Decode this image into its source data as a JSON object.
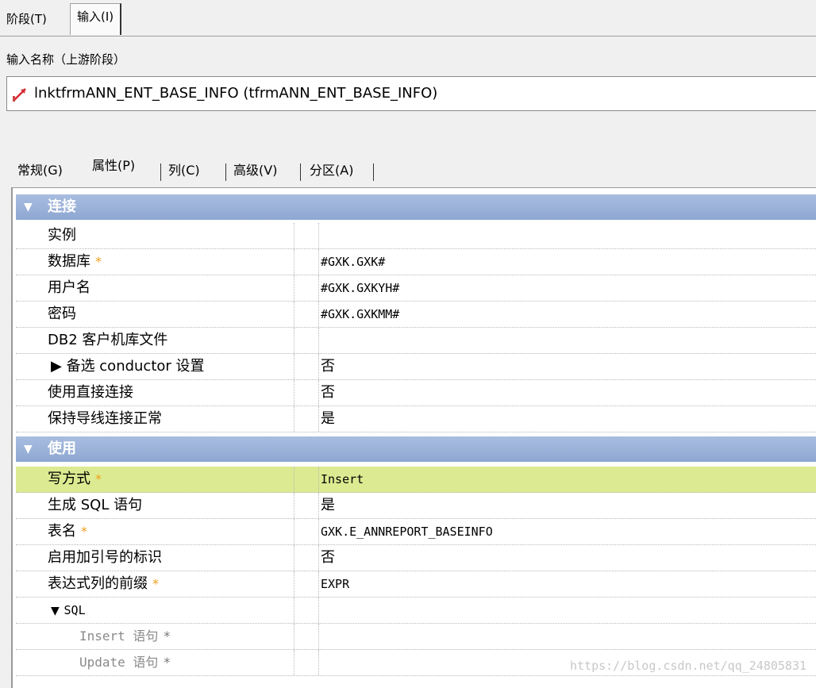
{
  "top_tabs": [
    "阶段(T)",
    "输入(I)"
  ],
  "input_label": "输入名称（上游阶段）",
  "input_value": "lnktfrmANN_ENT_BASE_INFO (tfrmANN_ENT_BASE_INFO)",
  "inner_tabs": [
    "常规(G)",
    "属性(P)",
    "列(C)",
    "高级(V)",
    "分区(A)"
  ],
  "sections": {
    "connection": {
      "title": "连接",
      "rows": [
        {
          "name": "实例",
          "value": ""
        },
        {
          "name": "数据库",
          "value": "#GXK.GXK#"
        },
        {
          "name": "用户名",
          "value": "#GXK.GXKYH#"
        },
        {
          "name": "密码",
          "value": "#GXK.GXKMM#"
        },
        {
          "name": "DB2 客户机库文件",
          "value": ""
        },
        {
          "name": "▶ 备选 conductor 设置",
          "value": "否"
        },
        {
          "name": "使用直接连接",
          "value": "否"
        },
        {
          "name": "保持导线连接正常",
          "value": "是"
        }
      ]
    },
    "usage": {
      "title": "使用",
      "rows": [
        {
          "name": "写方式",
          "value": "Insert"
        },
        {
          "name": "生成 SQL 语句",
          "value": "是"
        },
        {
          "name": "表名",
          "value": "GXK.E_ANNREPORT_BASEINFO"
        },
        {
          "name": "启用加引号的标识",
          "value": "否"
        },
        {
          "name": "表达式列的前缀",
          "value": "EXPR"
        },
        {
          "name": "SQL",
          "value": ""
        },
        {
          "name": "Insert 语句",
          "value": ""
        },
        {
          "name": "Update 语句",
          "value": ""
        }
      ]
    }
  },
  "required_marker": "*",
  "watermark": "https://blog.csdn.net/qq_24805831"
}
